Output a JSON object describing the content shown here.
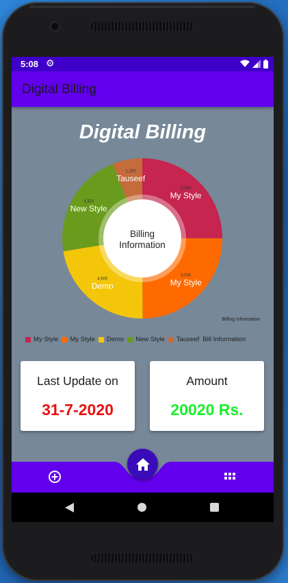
{
  "status_bar": {
    "time": "5:08",
    "icons": [
      "gear-icon",
      "wifi-icon",
      "signal-icon",
      "battery-icon"
    ]
  },
  "app_bar": {
    "title": "Digital Billing"
  },
  "content": {
    "title": "Digital Billing"
  },
  "chart_data": {
    "type": "pie",
    "center_text": [
      "Billing",
      "Information"
    ],
    "description": "Billing Information",
    "slices": [
      {
        "label": "My Style",
        "value": 5000,
        "value_label": "5,000",
        "color": "#c5254e"
      },
      {
        "label": "My Style",
        "value": 5000,
        "value_label": "5,000",
        "color": "#ff6a00"
      },
      {
        "label": "Demo",
        "value": 4500,
        "value_label": "4,500",
        "color": "#f4c60a"
      },
      {
        "label": "New Style",
        "value": 4320,
        "value_label": "4,320",
        "color": "#6a9b1c"
      },
      {
        "label": "Tauseef",
        "value": 1200,
        "value_label": "1,200",
        "color": "#c56b3c"
      }
    ],
    "legend": {
      "placement": "bottom-left",
      "items": [
        "My Style",
        "My Style",
        "Demo",
        "New Style",
        "Tauseef"
      ],
      "dataset_label": "Bill Information"
    }
  },
  "cards": {
    "last_update": {
      "title": "Last Update on",
      "value": "31-7-2020",
      "color": "#e81010"
    },
    "amount": {
      "title": "Amount",
      "value": "20020 Rs.",
      "color": "#18f028"
    }
  },
  "bottom_nav": {
    "left_icon": "add-circle-icon",
    "center_icon": "home-icon",
    "right_icon": "grid-icon",
    "bar_color": "#6200ee"
  },
  "system_nav": {
    "icons": [
      "back-icon",
      "home-circle-icon",
      "recents-square-icon"
    ]
  }
}
